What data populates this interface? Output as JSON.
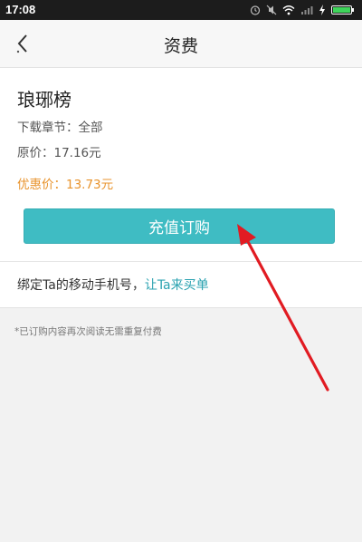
{
  "status_bar": {
    "time": "17:08",
    "icons": [
      "alarm-icon",
      "mute-icon",
      "wifi-icon",
      "signal-icon",
      "charging-icon",
      "battery-icon"
    ]
  },
  "header": {
    "title": "资费",
    "back_icon": "chevron-left-icon"
  },
  "book": {
    "title": "琅琊榜",
    "chapters": "下载章节：全部",
    "original_price": "原价：17.16元",
    "discount_price": "优惠价：13.73元"
  },
  "buy_button": {
    "label": "充值订购"
  },
  "bind": {
    "text": "绑定Ta的移动手机号，",
    "link": "让Ta来买单"
  },
  "note": "*已订购内容再次阅读无需重复付费",
  "colors": {
    "accent": "#3fbcc3",
    "discount": "#e8932c",
    "link": "#2aa2b0",
    "annotation_arrow": "#e11b22"
  }
}
